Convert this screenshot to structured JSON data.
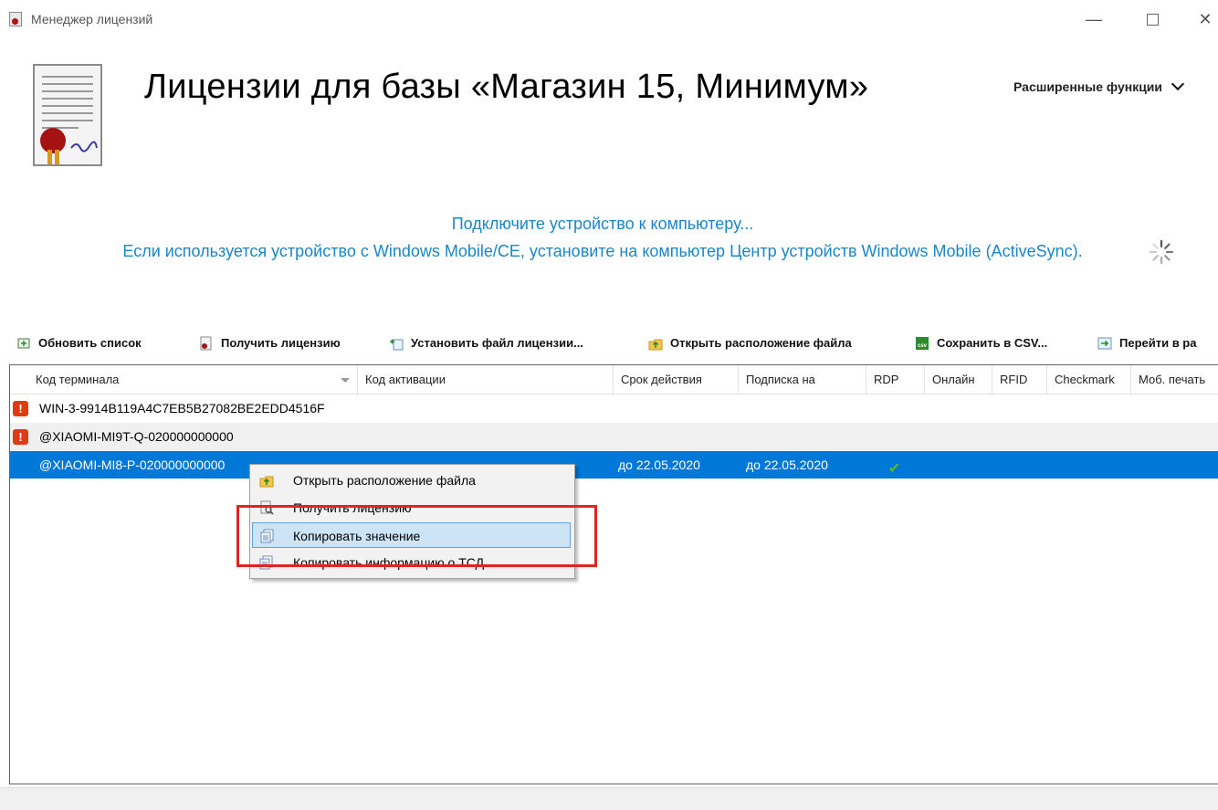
{
  "window": {
    "title": "Менеджер лицензий",
    "minimize": "—",
    "close": "✕"
  },
  "header": {
    "title": "Лицензии для базы «Магазин 15, Минимум»",
    "advanced_button": "Расширенные функции"
  },
  "info": {
    "line1": "Подключите устройство к компьютеру...",
    "line2": "Если используется устройство с Windows Mobile/CE, установите на компьютер Центр устройств Windows Mobile (ActiveSync)."
  },
  "toolbar": {
    "refresh": "Обновить список",
    "get_license": "Получить лицензию",
    "install_file": "Установить файл лицензии...",
    "open_location": "Открыть расположение файла",
    "save_csv": "Сохранить в CSV...",
    "go_to": "Перейти в ра"
  },
  "grid": {
    "columns": [
      "Код терминала",
      "Код активации",
      "Срок действия",
      "Подписка на",
      "RDP",
      "Онлайн",
      "RFID",
      "Checkmark",
      "Моб. печать"
    ],
    "rows": [
      {
        "terminal": "WIN-3-9914B119A4C7EB5B27082BE2EDD4516F",
        "status": "warning",
        "expiry": "",
        "subscription": "",
        "rdp": false
      },
      {
        "terminal": "@XIAOMI-MI9T-Q-020000000000",
        "status": "warning",
        "expiry": "",
        "subscription": "",
        "rdp": false
      },
      {
        "terminal": "@XIAOMI-MI8-P-020000000000",
        "status": "selected",
        "expiry": "до 22.05.2020",
        "subscription": "до 22.05.2020",
        "rdp": true
      }
    ]
  },
  "context_menu": {
    "items": [
      {
        "label": "Открыть расположение файла",
        "icon": "folder-up-icon"
      },
      {
        "label": "Получить лицензию",
        "icon": "document-search-icon"
      },
      {
        "label": "Копировать значение",
        "icon": "copy-icon",
        "hovered": true
      },
      {
        "label": "Копировать информацию о ТСД",
        "icon": "copy-info-icon"
      }
    ]
  },
  "colors": {
    "accent": "#1a86c8",
    "selection": "#0078d7",
    "highlight_box": "#e32424",
    "warning": "#e03a13"
  }
}
